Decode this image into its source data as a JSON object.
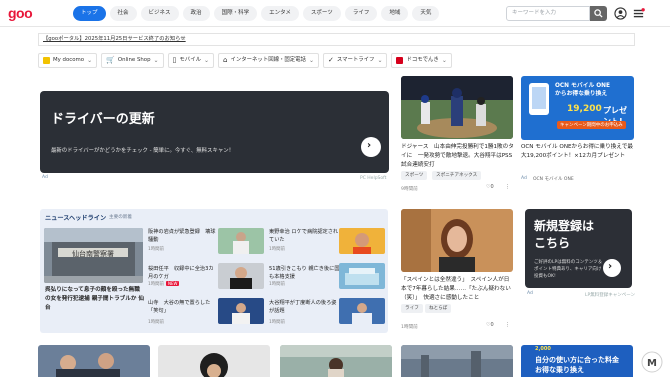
{
  "header": {
    "logo": "goo",
    "nav": [
      "トップ",
      "社会",
      "ビジネス",
      "政治",
      "国際・科学",
      "エンタメ",
      "スポーツ",
      "ライフ",
      "地域",
      "天気"
    ],
    "search_placeholder": "キーワードを入力"
  },
  "notice": "【gooポータル】2025年11月25日サービス終了のお知らせ",
  "services": [
    {
      "label": "My docomo",
      "icon": "docomo-icon",
      "color": "#f2c200"
    },
    {
      "label": "Online Shop",
      "icon": "cart-icon",
      "color": "#444444"
    },
    {
      "label": "モバイル",
      "icon": "mobile-icon",
      "color": "#444444"
    },
    {
      "label": "インターネット回線・固定電話",
      "icon": "internet-icon",
      "color": "#444444"
    },
    {
      "label": "スマートライフ",
      "icon": "smartlife-icon",
      "color": "#444444"
    },
    {
      "label": "ドコモでんき",
      "icon": "denki-icon",
      "color": "#d6001c"
    }
  ],
  "main_banner": {
    "title": "ドライバーの更新",
    "desc": "最新のドライバーがかどうかをチェック - 簡単に。今すぐ、無料スキャン！",
    "ad": "Ad",
    "source": "PC HelpSoft"
  },
  "top_card": {
    "title": "ドジャース　山本由伸完投勝利で1勝1敗のタイに　一発攻勢で敵地撃退。大谷翔平はPSS試合連続安打",
    "tags": [
      "スポーツ",
      "スポニチアネックス"
    ],
    "meta": "9時間前",
    "likes": "0"
  },
  "ocn_banner": {
    "line1": "OCN モバイル ONE",
    "line2": "からお得な乗り換え",
    "amount": "19,200",
    "unit": "円相当",
    "suffix": "プレゼント!",
    "cta": "キャンペーン期間中のお申込み"
  },
  "ocn_card": {
    "title": "OCN モバイル ONEからお得に乗り換えで最大19,200ポイント！×12カ月プレゼント",
    "ad": "Ad",
    "source": "OCN モバイル ONE"
  },
  "headlines": {
    "title": "ニュースヘッドライン",
    "subtitle": "主要の新着",
    "main_title": "呉弘りになって息子の顔を殴った無職の女を発行犯逮捕 親子間トラブルか 仙台",
    "items": [
      {
        "title": "阪神の岩貞が緊急登録　壊球騒動",
        "meta": "1時間前"
      },
      {
        "title": "東野幸治 ロケで病院認定されていた",
        "meta": "1時間前"
      },
      {
        "title": "桜田任平　収録中に全治3カ月のケガ",
        "meta": "1時間前",
        "badge": "NEW"
      },
      {
        "title": "51歳引きこもり 親亡き後に国も本格支援",
        "meta": "1時間前"
      },
      {
        "title": "山寺　大谷の無で置らした「笑句」",
        "meta": "1時間前"
      },
      {
        "title": "大谷翔平が丁度断人の後ろ姿が話題",
        "meta": "1時間前"
      }
    ]
  },
  "mid_card": {
    "title": "「スペインとは全然違う」　スペイン人が日本で7年暮らした結果……「たぶん疑わない（笑）」　快適さに感動したこと",
    "tags": [
      "ライフ",
      "ねとらぼ"
    ],
    "meta": "1時間前",
    "likes": "0"
  },
  "signup_banner": {
    "line1": "新規登録は",
    "line2": "こちら",
    "desc": "ご好評のLPは無料のコンテンツ＆ポイント特典あり、キャリア向け投資もOK!",
    "ad": "Ad",
    "source": "LP無料登録キャンペーン"
  },
  "bottom_banner": {
    "line1": "自分の使い方に合った料金",
    "line2": "お得な乗り換え",
    "amount": "2,000"
  }
}
